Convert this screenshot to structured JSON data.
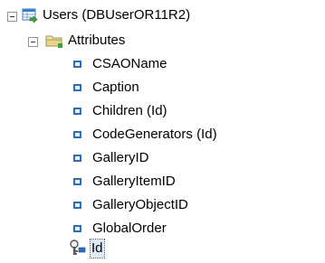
{
  "tree": {
    "root": {
      "label": "Users (DBUserOR11R2)",
      "icon": "table-icon",
      "expanded": true
    },
    "attributes": {
      "label": "Attributes",
      "icon": "folder-icon",
      "expanded": true,
      "items": [
        {
          "label": "CSAOName",
          "icon": "attribute-icon"
        },
        {
          "label": "Caption",
          "icon": "attribute-icon"
        },
        {
          "label": "Children (Id)",
          "icon": "attribute-icon"
        },
        {
          "label": "CodeGenerators (Id)",
          "icon": "attribute-icon"
        },
        {
          "label": "GalleryID",
          "icon": "attribute-icon"
        },
        {
          "label": "GalleryItemID",
          "icon": "attribute-icon"
        },
        {
          "label": "GalleryObjectID",
          "icon": "attribute-icon"
        },
        {
          "label": "GlobalOrder",
          "icon": "attribute-icon"
        },
        {
          "label": "Id",
          "icon": "key-icon",
          "selected": true
        }
      ]
    },
    "colors": {
      "bullet": "#2b6cc4",
      "folder": "#e7d58f",
      "table": "#3f7fc8",
      "green_arrow": "#3aa33a"
    }
  }
}
